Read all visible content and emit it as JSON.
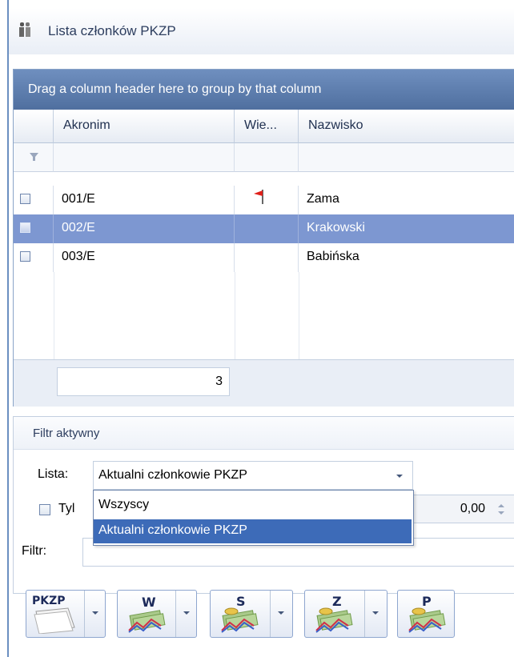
{
  "window": {
    "title": "Lista członków PKZP"
  },
  "grid": {
    "group_hint": "Drag a column header here to group by that column",
    "columns": [
      "Akronim",
      "Wie...",
      "Nazwisko"
    ],
    "rows": [
      {
        "akronim": "001/E",
        "nazwisko": "Zama",
        "flag": true,
        "selected": false
      },
      {
        "akronim": "002/E",
        "nazwisko": "Krakowski",
        "flag": false,
        "selected": true
      },
      {
        "akronim": "003/E",
        "nazwisko": "Babińska",
        "flag": false,
        "selected": false
      }
    ],
    "footer_count": "3"
  },
  "filter": {
    "header": "Filtr aktywny",
    "lista_label": "Lista:",
    "lista_value": "Aktualni członkowie PKZP",
    "tyl_label": "Tyl",
    "spin_value": "0,00",
    "filtr_label": "Filtr:",
    "dropdown_options": [
      "Wszyscy",
      "Aktualni członkowie PKZP"
    ],
    "dropdown_selected": "Aktualni członkowie PKZP"
  },
  "toolbar": {
    "buttons": [
      {
        "label": "PKZP",
        "has_dropdown": true
      },
      {
        "label": "W",
        "has_dropdown": true
      },
      {
        "label": "S",
        "has_dropdown": true
      },
      {
        "label": "Z",
        "has_dropdown": true
      },
      {
        "label": "P",
        "has_dropdown": false
      }
    ]
  },
  "colors": {
    "selection": "#7d97d1",
    "group_bar": "#5f7fb0",
    "dropdown_selection": "#3d6bb8",
    "flag": "#e0201a"
  }
}
